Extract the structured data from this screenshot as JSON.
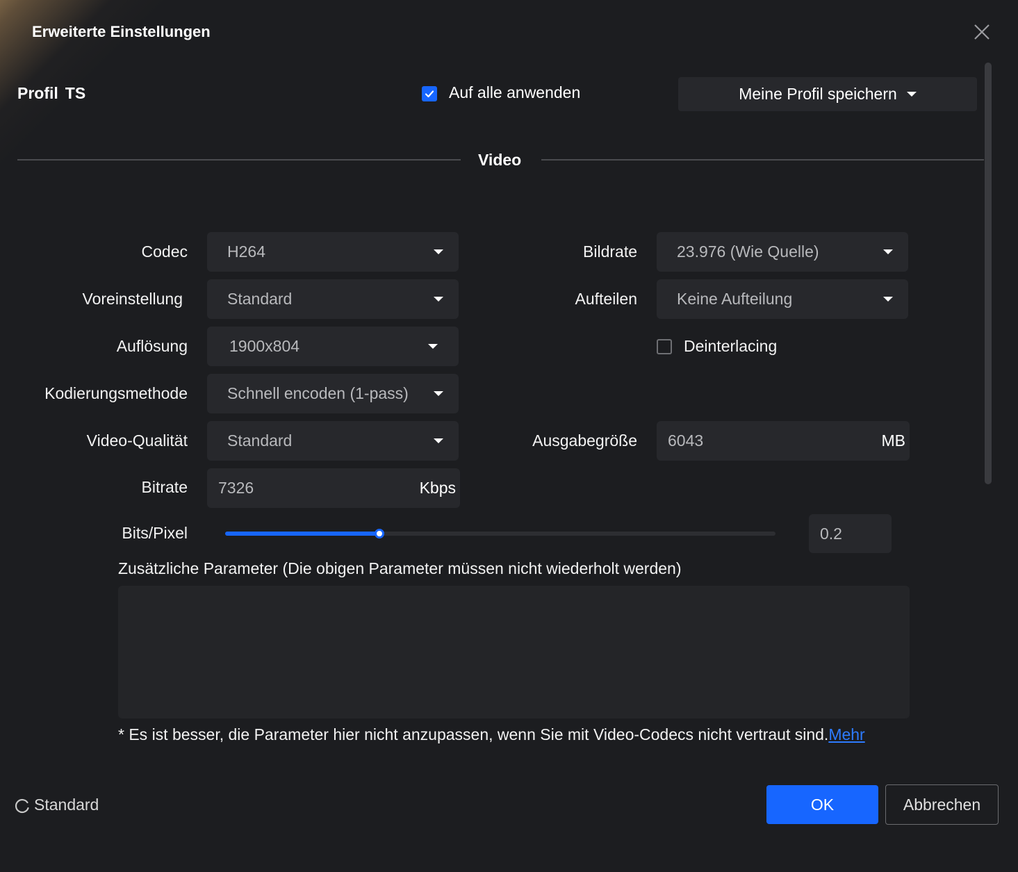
{
  "dialog": {
    "title": "Erweiterte Einstellungen"
  },
  "profile": {
    "label": "Profil",
    "value": "TS"
  },
  "apply_all": {
    "label": "Auf alle anwenden",
    "checked": true
  },
  "save_profile": {
    "label": "Meine Profil speichern"
  },
  "section": {
    "title": "Video"
  },
  "fields": {
    "codec": {
      "label": "Codec",
      "value": "H264"
    },
    "preset": {
      "label": "Voreinstellung",
      "value": "Standard"
    },
    "resolution": {
      "label": "Auflösung",
      "value": "1900x804"
    },
    "encoding": {
      "label": "Kodierungsmethode",
      "value": "Schnell encoden (1-pass)"
    },
    "quality": {
      "label": "Video-Qualität",
      "value": "Standard"
    },
    "bitrate": {
      "label": "Bitrate",
      "value": "7326",
      "unit": "Kbps"
    },
    "framerate": {
      "label": "Bildrate",
      "value": "23.976 (Wie Quelle)"
    },
    "split": {
      "label": "Aufteilen",
      "value": "Keine Aufteilung"
    },
    "deinterlacing": {
      "label": "Deinterlacing",
      "checked": false
    },
    "output_size": {
      "label": "Ausgabegröße",
      "value": "6043",
      "unit": "MB"
    }
  },
  "bits_pixel": {
    "label": "Bits/Pixel",
    "value": "0.2",
    "slider_fraction": 0.28
  },
  "extra_params": {
    "label": "Zusätzliche Parameter (Die obigen Parameter müssen nicht wiederholt werden)",
    "value": ""
  },
  "hint": {
    "text": "* Es ist besser, die Parameter hier nicht anzupassen, wenn Sie mit Video-Codecs nicht vertraut sind.",
    "link": "Mehr"
  },
  "footer": {
    "reset_label": "Standard",
    "ok_label": "OK",
    "cancel_label": "Abbrechen"
  },
  "colors": {
    "accent": "#1766ff",
    "background": "#1c1d20",
    "control": "#27282c",
    "link": "#2d7bff"
  }
}
